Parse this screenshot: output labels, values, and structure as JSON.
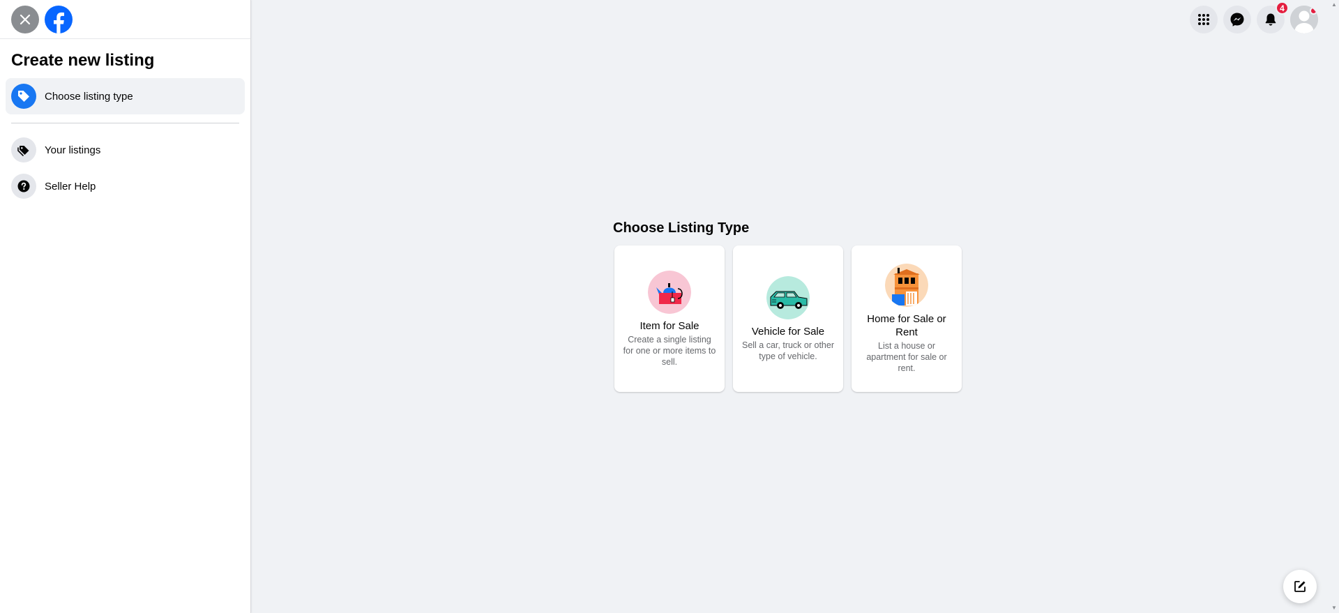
{
  "sidebar": {
    "title": "Create new listing",
    "items": [
      {
        "label": "Choose listing type",
        "icon": "tag-icon",
        "active": true
      },
      {
        "label": "Your listings",
        "icon": "tags-icon",
        "active": false
      },
      {
        "label": "Seller Help",
        "icon": "question-icon",
        "active": false
      }
    ]
  },
  "header": {
    "notification_count": "4",
    "icons": [
      "menu-grid-icon",
      "messenger-icon",
      "bell-icon",
      "avatar"
    ]
  },
  "main": {
    "heading": "Choose Listing Type",
    "cards": [
      {
        "title": "Item for Sale",
        "description": "Create a single listing for one or more items to sell.",
        "icon": "item-for-sale-illustration"
      },
      {
        "title": "Vehicle for Sale",
        "description": "Sell a car, truck or other type of vehicle.",
        "icon": "vehicle-for-sale-illustration"
      },
      {
        "title": "Home for Sale or Rent",
        "description": "List a house or apartment for sale or rent.",
        "icon": "home-for-sale-illustration"
      }
    ]
  },
  "colors": {
    "brand_blue": "#1877f2",
    "page_background": "#f0f2f5",
    "badge_red": "#e41e3f"
  }
}
